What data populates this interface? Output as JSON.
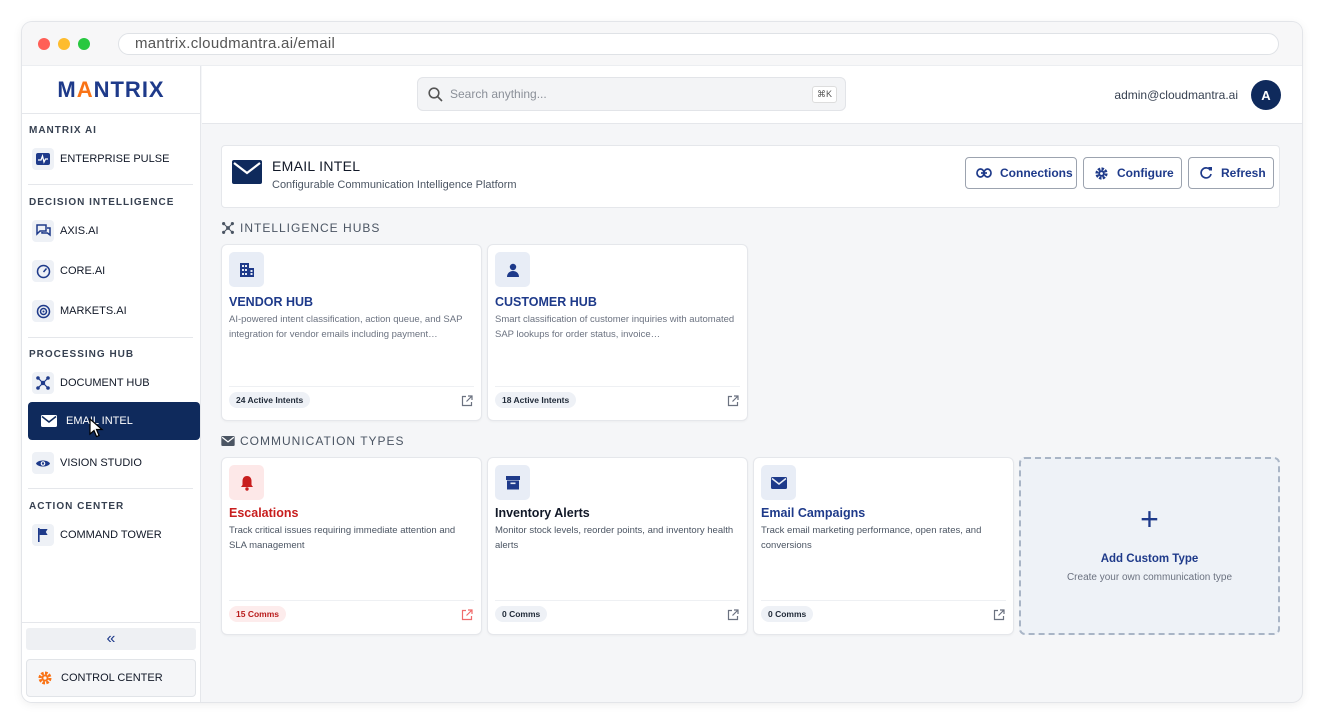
{
  "browser": {
    "url": "mantrix.cloudmantra.ai/email"
  },
  "brand": {
    "logo_left": "M",
    "logo_accent": "A",
    "logo_right": "NTRIX",
    "accent": "#f97316",
    "primary": "#0f2a5c"
  },
  "sidebar": {
    "sections": [
      {
        "title": "MANTRIX AI",
        "items": [
          {
            "label": "ENTERPRISE PULSE",
            "icon": "pulse-icon"
          }
        ]
      },
      {
        "title": "DECISION INTELLIGENCE",
        "items": [
          {
            "label": "AXIS.AI",
            "icon": "chat-icon"
          },
          {
            "label": "CORE.AI",
            "icon": "gauge-icon"
          },
          {
            "label": "MARKETS.AI",
            "icon": "target-icon"
          }
        ]
      },
      {
        "title": "PROCESSING HUB",
        "items": [
          {
            "label": "DOCUMENT HUB",
            "icon": "hub-icon"
          },
          {
            "label": "EMAIL INTEL",
            "icon": "mail-icon",
            "active": true
          },
          {
            "label": "VISION STUDIO",
            "icon": "eye-icon"
          }
        ]
      },
      {
        "title": "ACTION CENTER",
        "items": [
          {
            "label": "COMMAND TOWER",
            "icon": "flag-icon"
          }
        ]
      }
    ],
    "collapse_label": "«",
    "control_center": "CONTROL CENTER"
  },
  "topbar": {
    "search_placeholder": "Search anything...",
    "shortcut": "⌘K",
    "user_email": "admin@cloudmantra.ai",
    "avatar_initial": "A"
  },
  "header": {
    "title": "EMAIL INTEL",
    "subtitle": "Configurable Communication Intelligence Platform",
    "buttons": {
      "connections": "Connections",
      "configure": "Configure",
      "refresh": "Refresh"
    }
  },
  "intelligence_hubs": {
    "title": "INTELLIGENCE HUBS",
    "cards": [
      {
        "title": "VENDOR HUB",
        "desc": "AI-powered intent classification, action queue, and SAP integration for vendor emails including payment…",
        "badge": "24 Active Intents"
      },
      {
        "title": "CUSTOMER HUB",
        "desc": "Smart classification of customer inquiries with automated SAP lookups for order status, invoice…",
        "badge": "18 Active Intents"
      }
    ]
  },
  "communication_types": {
    "title": "COMMUNICATION TYPES",
    "cards": [
      {
        "title": "Escalations",
        "desc": "Track critical issues requiring immediate attention and SLA management",
        "badge": "15 Comms",
        "color": "#c81e1e"
      },
      {
        "title": "Inventory Alerts",
        "desc": "Monitor stock levels, reorder points, and inventory health alerts",
        "badge": "0 Comms"
      },
      {
        "title": "Email Campaigns",
        "desc": "Track email marketing performance, open rates, and conversions",
        "badge": "0 Comms"
      }
    ],
    "add": {
      "plus": "+",
      "title": "Add Custom Type",
      "desc": "Create your own communication type"
    }
  }
}
